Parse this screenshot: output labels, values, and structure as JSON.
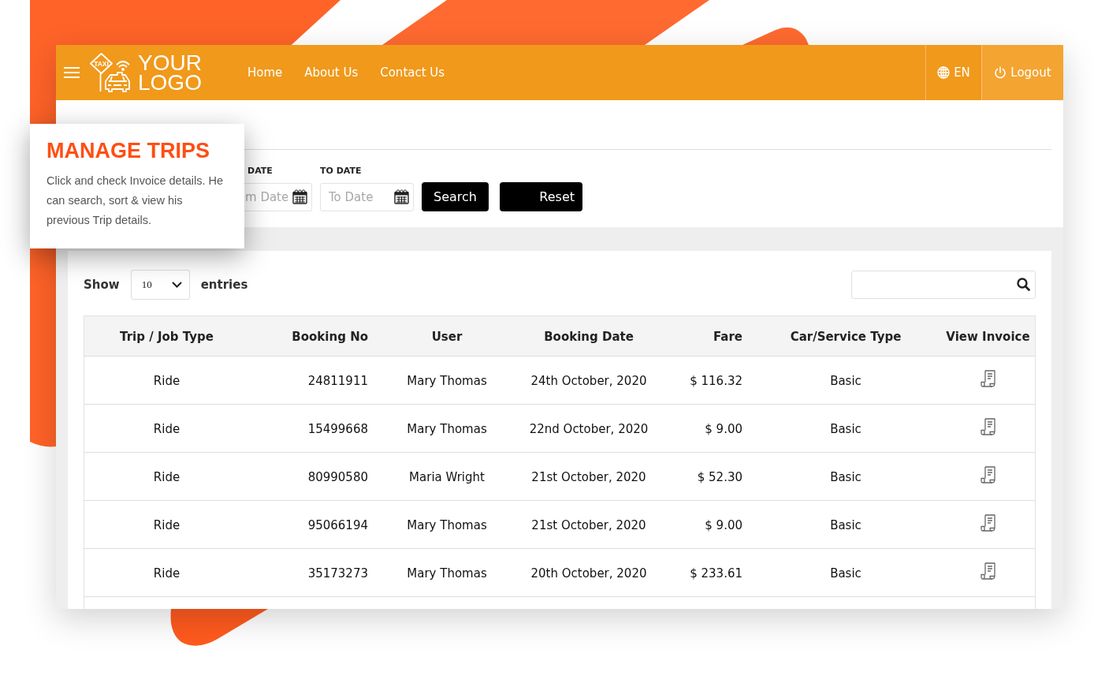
{
  "header": {
    "logo": {
      "sign_text": "TAXI",
      "lines": [
        "YOUR",
        "LOGO"
      ]
    },
    "nav": [
      {
        "label": "Home"
      },
      {
        "label": "About Us"
      },
      {
        "label": "Contact Us"
      }
    ],
    "language": "EN",
    "logout": "Logout"
  },
  "filters": {
    "from_date": {
      "label": "DATE",
      "placeholder": "m Date"
    },
    "to_date": {
      "label": "TO DATE",
      "placeholder": "To Date"
    },
    "buttons": [
      "Search",
      "Reset"
    ]
  },
  "entries": {
    "show_label": "Show",
    "page_size": "10",
    "entries_label": "entries"
  },
  "table": {
    "columns": [
      "Trip / Job Type",
      "Booking No",
      "User",
      "Booking Date",
      "Fare",
      "Car/Service Type",
      "View Invoice"
    ],
    "rows": [
      {
        "cells": [
          "Ride",
          "24811911",
          "Mary Thomas",
          "24th October, 2020",
          "$ 116.32",
          "Basic"
        ]
      },
      {
        "cells": [
          "Ride",
          "15499668",
          "Mary Thomas",
          "22nd October, 2020",
          "$ 9.00",
          "Basic"
        ]
      },
      {
        "cells": [
          "Ride",
          "80990580",
          "Maria Wright",
          "21st October, 2020",
          "$ 52.30",
          "Basic"
        ]
      },
      {
        "cells": [
          "Ride",
          "95066194",
          "Mary Thomas",
          "21st October, 2020",
          "$ 9.00",
          "Basic"
        ]
      },
      {
        "cells": [
          "Ride",
          "35173273",
          "Mary Thomas",
          "20th October, 2020",
          "$ 233.61",
          "Basic"
        ]
      }
    ]
  },
  "callout": {
    "title": "MANAGE TRIPS",
    "text": "Click and check Invoice details. He can search, sort & view his previous Trip details."
  }
}
